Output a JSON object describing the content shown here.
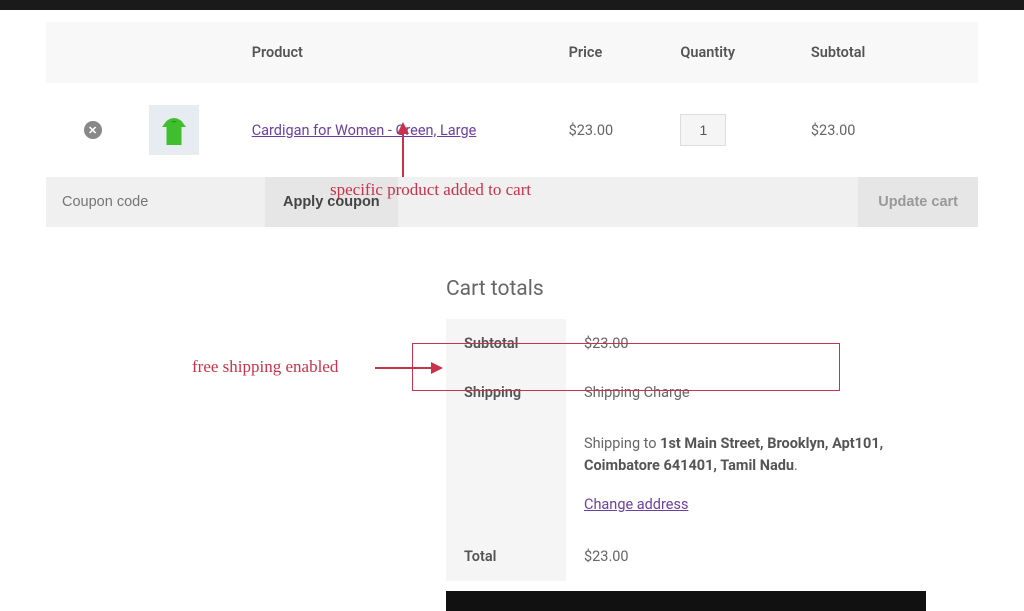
{
  "table": {
    "headers": {
      "product": "Product",
      "price": "Price",
      "quantity": "Quantity",
      "subtotal": "Subtotal"
    },
    "row": {
      "product_link": "Cardigan for Women - Green, Large",
      "price": "$23.00",
      "quantity": "1",
      "subtotal": "$23.00"
    }
  },
  "coupon": {
    "placeholder": "Coupon code",
    "apply_label": "Apply coupon"
  },
  "update_label": "Update cart",
  "totals": {
    "title": "Cart totals",
    "subtotal_label": "Subtotal",
    "subtotal_value": "$23.00",
    "shipping_label": "Shipping",
    "shipping_method": "Shipping Charge",
    "shipping_to_prefix": "Shipping to ",
    "shipping_address": "1st Main Street, Brooklyn, Apt101, Coimbatore 641401, Tamil Nadu",
    "change_address": "Change address",
    "total_label": "Total",
    "total_value": "$23.00"
  },
  "annotations": {
    "product": "specific product added to cart",
    "shipping": "free shipping enabled"
  }
}
